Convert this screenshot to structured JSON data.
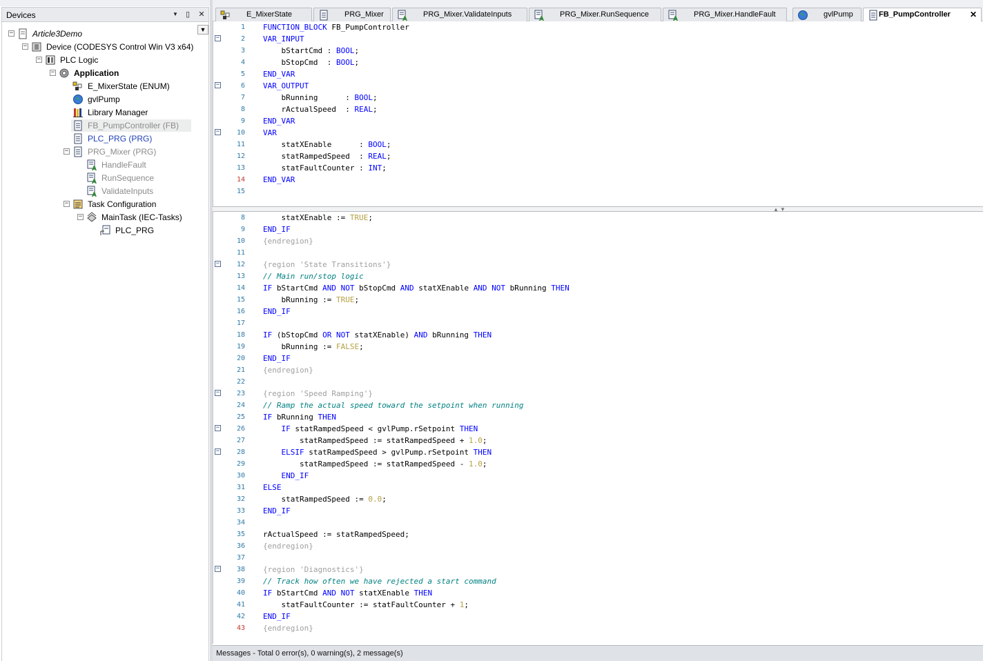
{
  "devices": {
    "title": "Devices",
    "header_buttons": [
      "▼",
      "▯",
      "✕"
    ],
    "tree": [
      {
        "label": "Article3Demo",
        "style": "ital",
        "icon": "project-icon",
        "expander": "−"
      },
      {
        "label": "Device (CODESYS Control Win V3 x64)",
        "style": "",
        "icon": "device-icon",
        "expander": "−"
      },
      {
        "label": "PLC Logic",
        "style": "",
        "icon": "plc-logic-icon",
        "expander": "−"
      },
      {
        "label": "Application",
        "style": "bold",
        "icon": "gear-icon",
        "expander": "−"
      },
      {
        "label": "E_MixerState (ENUM)",
        "style": "",
        "icon": "enum-icon",
        "expander": ""
      },
      {
        "label": "gvlPump",
        "style": "",
        "icon": "globe-icon",
        "expander": ""
      },
      {
        "label": "Library Manager",
        "style": "",
        "icon": "library-icon",
        "expander": ""
      },
      {
        "label": "FB_PumpController (FB)",
        "style": "gray",
        "icon": "pou-icon",
        "expander": "",
        "selected": true
      },
      {
        "label": "PLC_PRG (PRG)",
        "style": "blue",
        "icon": "pou-icon",
        "expander": ""
      },
      {
        "label": "PRG_Mixer (PRG)",
        "style": "gray",
        "icon": "pou-icon",
        "expander": "−"
      },
      {
        "label": "HandleFault",
        "style": "gray",
        "icon": "action-icon",
        "expander": ""
      },
      {
        "label": "RunSequence",
        "style": "gray",
        "icon": "action-icon",
        "expander": ""
      },
      {
        "label": "ValidateInputs",
        "style": "gray",
        "icon": "action-icon",
        "expander": ""
      },
      {
        "label": "Task Configuration",
        "style": "",
        "icon": "task-config-icon",
        "expander": "−"
      },
      {
        "label": "MainTask (IEC-Tasks)",
        "style": "",
        "icon": "task-icon",
        "expander": "−"
      },
      {
        "label": "PLC_PRG",
        "style": "",
        "icon": "program-call-icon",
        "expander": ""
      }
    ]
  },
  "tabs": [
    {
      "label": "E_MixerState",
      "icon": "enum-icon",
      "active": false
    },
    {
      "label": "PRG_Mixer",
      "icon": "pou-icon",
      "active": false
    },
    {
      "label": "PRG_Mixer.ValidateInputs",
      "icon": "action-icon",
      "active": false
    },
    {
      "label": "PRG_Mixer.RunSequence",
      "icon": "action-icon",
      "active": false
    },
    {
      "label": "PRG_Mixer.HandleFault",
      "icon": "action-icon",
      "active": false
    },
    {
      "label": "gvlPump",
      "icon": "globe-icon",
      "active": false
    },
    {
      "label": "FB_PumpController",
      "icon": "pou-icon",
      "active": true,
      "close": "✕"
    }
  ],
  "declaration": [
    {
      "ln": "1",
      "fold": "",
      "code": "[[kw:FUNCTION_BLOCK]] FB_PumpController"
    },
    {
      "ln": "2",
      "fold": "−",
      "code": "[[kw:VAR_INPUT]]"
    },
    {
      "ln": "3",
      "fold": "",
      "code": "    bStartCmd : [[kw:BOOL]];"
    },
    {
      "ln": "4",
      "fold": "",
      "code": "    bStopCmd  : [[kw:BOOL]];"
    },
    {
      "ln": "5",
      "fold": "",
      "code": "[[kw:END_VAR]]"
    },
    {
      "ln": "6",
      "fold": "−",
      "code": "[[kw:VAR_OUTPUT]]"
    },
    {
      "ln": "7",
      "fold": "",
      "code": "    bRunning      : [[kw:BOOL]];"
    },
    {
      "ln": "8",
      "fold": "",
      "code": "    rActualSpeed  : [[kw:REAL]];"
    },
    {
      "ln": "9",
      "fold": "",
      "code": "[[kw:END_VAR]]"
    },
    {
      "ln": "10",
      "fold": "−",
      "code": "[[kw:VAR]]"
    },
    {
      "ln": "11",
      "fold": "",
      "code": "    statXEnable      : [[kw:BOOL]];"
    },
    {
      "ln": "12",
      "fold": "",
      "code": "    statRampedSpeed  : [[kw:REAL]];"
    },
    {
      "ln": "13",
      "fold": "",
      "code": "    statFaultCounter : [[kw:INT]];"
    },
    {
      "ln": "14",
      "fold": "",
      "code": "[[kw:END_VAR]]",
      "red": true
    },
    {
      "ln": "15",
      "fold": "",
      "code": ""
    }
  ],
  "implementation": [
    {
      "ln": "8",
      "fold": "",
      "code": "    statXEnable := [[nm:TRUE]];"
    },
    {
      "ln": "9",
      "fold": "",
      "code": "[[kw:END_IF]]"
    },
    {
      "ln": "10",
      "fold": "",
      "code": "[[rg:{endregion}]]"
    },
    {
      "ln": "11",
      "fold": "",
      "code": ""
    },
    {
      "ln": "12",
      "fold": "−",
      "code": "[[rg:{region 'State Transitions'}]]"
    },
    {
      "ln": "13",
      "fold": "",
      "code": "[[cm:// Main run/stop logic]]"
    },
    {
      "ln": "14",
      "fold": "",
      "code": "[[kw:IF]] bStartCmd [[kw:AND]] [[kw:NOT]] bStopCmd [[kw:AND]] statXEnable [[kw:AND]] [[kw:NOT]] bRunning [[kw:THEN]]"
    },
    {
      "ln": "15",
      "fold": "",
      "code": "    bRunning := [[nm:TRUE]];"
    },
    {
      "ln": "16",
      "fold": "",
      "code": "[[kw:END_IF]]"
    },
    {
      "ln": "17",
      "fold": "",
      "code": ""
    },
    {
      "ln": "18",
      "fold": "",
      "code": "[[kw:IF]] (bStopCmd [[kw:OR]] [[kw:NOT]] statXEnable) [[kw:AND]] bRunning [[kw:THEN]]"
    },
    {
      "ln": "19",
      "fold": "",
      "code": "    bRunning := [[nm:FALSE]];"
    },
    {
      "ln": "20",
      "fold": "",
      "code": "[[kw:END_IF]]"
    },
    {
      "ln": "21",
      "fold": "",
      "code": "[[rg:{endregion}]]"
    },
    {
      "ln": "22",
      "fold": "",
      "code": ""
    },
    {
      "ln": "23",
      "fold": "−",
      "code": "[[rg:{region 'Speed Ramping'}]]"
    },
    {
      "ln": "24",
      "fold": "",
      "code": "[[cm:// Ramp the actual speed toward the setpoint when running]]"
    },
    {
      "ln": "25",
      "fold": "",
      "code": "[[kw:IF]] bRunning [[kw:THEN]]"
    },
    {
      "ln": "26",
      "fold": "−",
      "code": "    [[kw:IF]] statRampedSpeed < gvlPump.rSetpoint [[kw:THEN]]"
    },
    {
      "ln": "27",
      "fold": "",
      "code": "        statRampedSpeed := statRampedSpeed + [[nm:1.0]];"
    },
    {
      "ln": "28",
      "fold": "−",
      "code": "    [[kw:ELSIF]] statRampedSpeed > gvlPump.rSetpoint [[kw:THEN]]"
    },
    {
      "ln": "29",
      "fold": "",
      "code": "        statRampedSpeed := statRampedSpeed - [[nm:1.0]];"
    },
    {
      "ln": "30",
      "fold": "",
      "code": "    [[kw:END_IF]]"
    },
    {
      "ln": "31",
      "fold": "",
      "code": "[[kw:ELSE]]"
    },
    {
      "ln": "32",
      "fold": "",
      "code": "    statRampedSpeed := [[nm:0.0]];"
    },
    {
      "ln": "33",
      "fold": "",
      "code": "[[kw:END_IF]]"
    },
    {
      "ln": "34",
      "fold": "",
      "code": ""
    },
    {
      "ln": "35",
      "fold": "",
      "code": "rActualSpeed := statRampedSpeed;"
    },
    {
      "ln": "36",
      "fold": "",
      "code": "[[rg:{endregion}]]"
    },
    {
      "ln": "37",
      "fold": "",
      "code": ""
    },
    {
      "ln": "38",
      "fold": "−",
      "code": "[[rg:{region 'Diagnostics'}]]"
    },
    {
      "ln": "39",
      "fold": "",
      "code": "[[cm:// Track how often we have rejected a start command]]"
    },
    {
      "ln": "40",
      "fold": "",
      "code": "[[kw:IF]] bStartCmd [[kw:AND]] [[kw:NOT]] statXEnable [[kw:THEN]]"
    },
    {
      "ln": "41",
      "fold": "",
      "code": "    statFaultCounter := statFaultCounter + [[nm:1]];"
    },
    {
      "ln": "42",
      "fold": "",
      "code": "[[kw:END_IF]]"
    },
    {
      "ln": "43",
      "fold": "",
      "code": "[[rg:{endregion}]]",
      "red": true
    }
  ],
  "messages": {
    "summary": "Messages - Total 0 error(s), 0 warning(s), 2 message(s)"
  },
  "colors": {
    "keyword": "#0000ff",
    "comment": "#008080",
    "region": "#a0a0a0",
    "literal": "#b5a046",
    "line_number": "#2b7aa8"
  }
}
